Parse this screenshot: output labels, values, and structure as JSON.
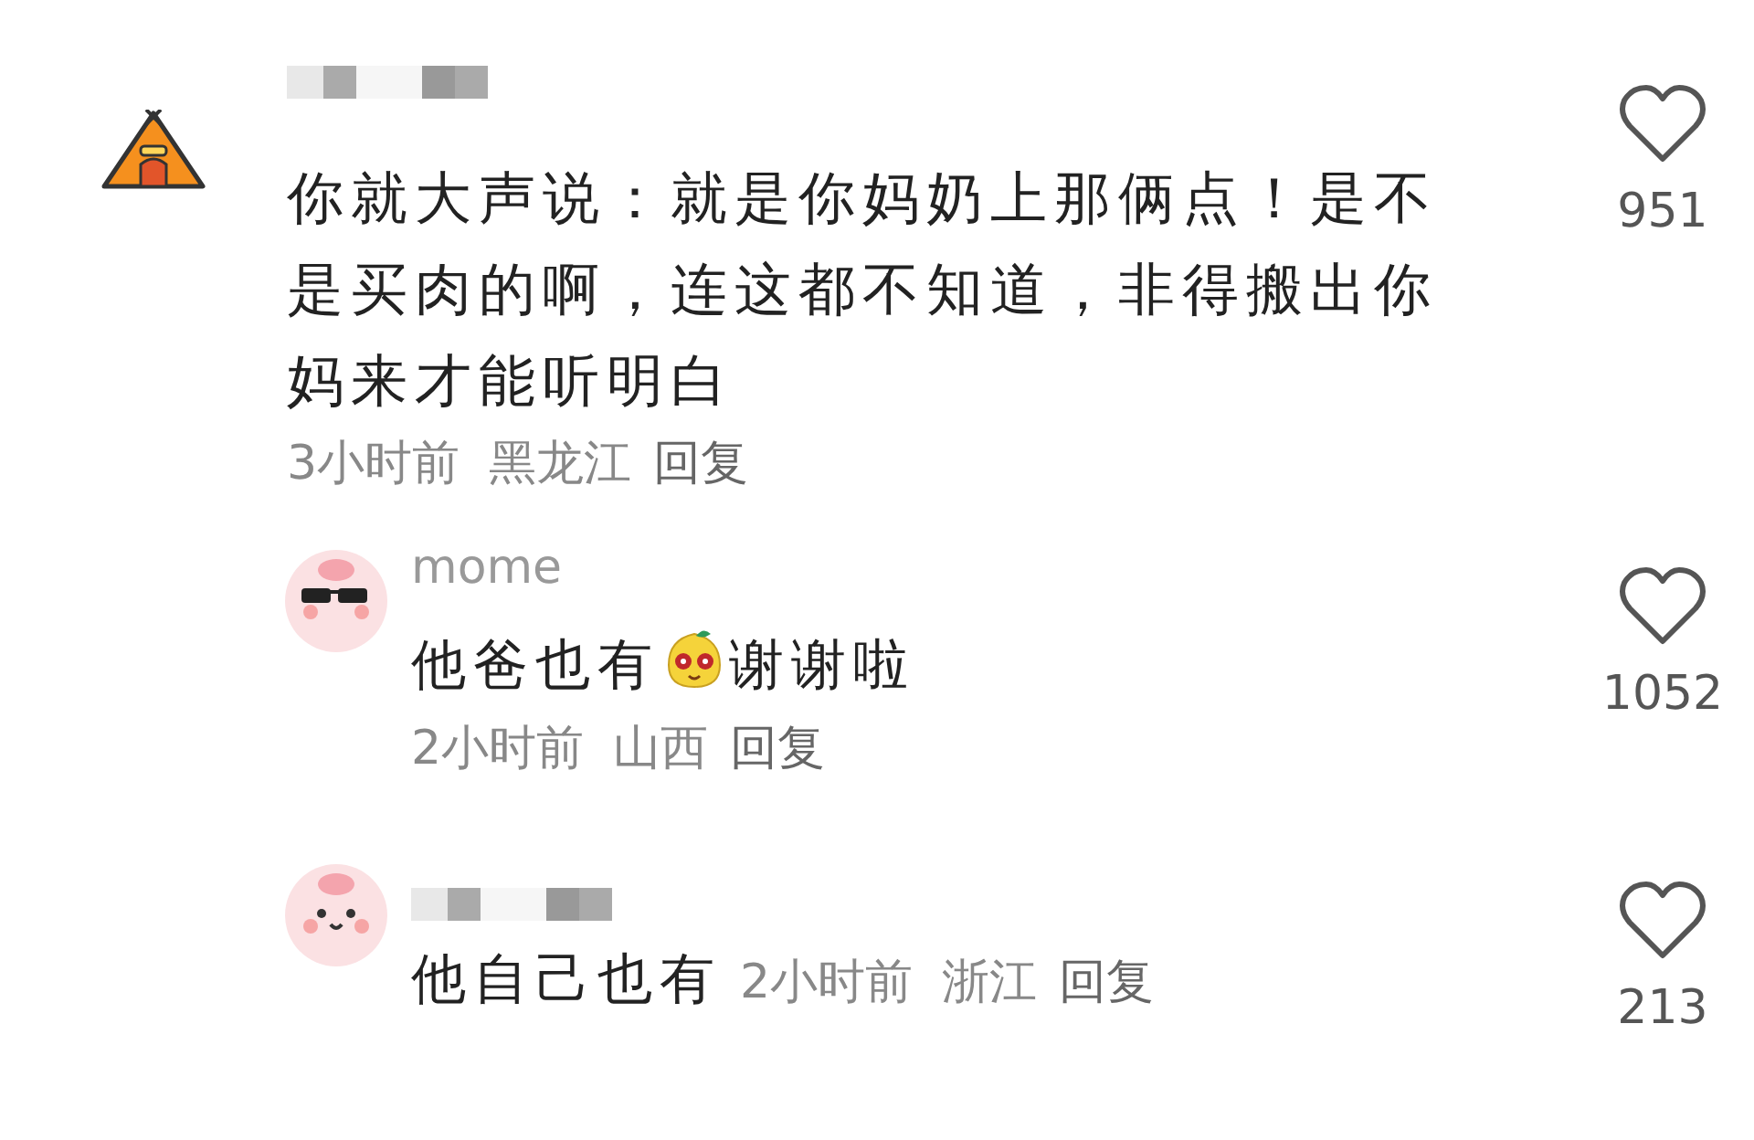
{
  "comments": [
    {
      "kind": "top",
      "segments": [
        {
          "kind": "text",
          "text": "你就大声说：就是你妈奶上那俩点！是不是买肉的啊，连这都不知道，非得搬出你妈来才能听明白"
        }
      ],
      "time": "3小时前",
      "location": "黑龙江",
      "reply": "回复",
      "likes": "951",
      "liked": false
    },
    {
      "kind": "reply",
      "username": "mome",
      "segments": [
        {
          "kind": "text",
          "text": "他爸也有"
        },
        {
          "kind": "emoji"
        },
        {
          "kind": "text",
          "text": "谢谢啦"
        }
      ],
      "time": "2小时前",
      "location": "山西",
      "reply": "回复",
      "likes": "1052",
      "liked": false
    },
    {
      "kind": "reply_inline",
      "segments": [
        {
          "kind": "text",
          "text": "他自己也有"
        }
      ],
      "time": "2小时前",
      "location": "浙江",
      "reply": "回复",
      "likes": "213",
      "liked": false
    }
  ]
}
